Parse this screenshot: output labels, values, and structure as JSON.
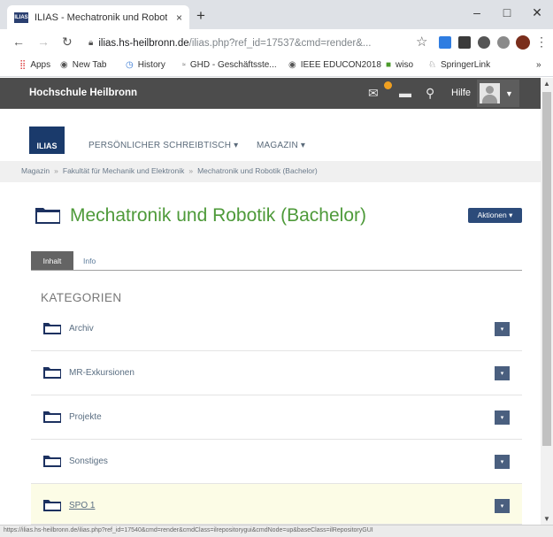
{
  "browser": {
    "tab_title": "ILIAS - Mechatronik und Robotik",
    "tab_close": "×",
    "new_tab": "+",
    "window_minimize": "–",
    "window_maximize": "□",
    "window_close": "✕",
    "url_host": "ilias.hs-heilbronn.de",
    "url_path": "/ilias.php?ref_id=17537&cmd=render&...",
    "bookmarks": [
      {
        "label": "Apps",
        "icon": "apps-grid-icon"
      },
      {
        "label": "New Tab",
        "icon": "chrome-icon"
      },
      {
        "label": "History",
        "icon": "history-icon"
      },
      {
        "label": "GHD - Geschäftsste...",
        "icon": "ghd-icon"
      },
      {
        "label": "IEEE EDUCON2018",
        "icon": "globe-icon"
      },
      {
        "label": "wiso",
        "icon": "wiso-icon"
      },
      {
        "label": "SpringerLink",
        "icon": "springer-icon"
      }
    ],
    "bookmarks_more": "»",
    "status_url": "https://ilias.hs-heilbronn.de/ilias.php?ref_id=17540&cmd=render&cmdClass=ilrepositorygui&cmdNode=up&baseClass=ilRepositoryGUI"
  },
  "ilias": {
    "brand": "Hochschule Heilbronn",
    "help": "Hilfe",
    "logo": "ILIAS",
    "mainnav": {
      "desk": "PERSÖNLICHER SCHREIBTISCH ▾",
      "magazin": "MAGAZIN ▾"
    },
    "breadcrumb": [
      "Magazin",
      "Fakultät für Mechanik und Elektronik",
      "Mechatronik und Robotik (Bachelor)"
    ],
    "breadcrumb_sep": "»",
    "page_title": "Mechatronik und Robotik (Bachelor)",
    "actions_button": "Aktionen ▾",
    "tabs": {
      "active": "Inhalt",
      "info": "Info"
    },
    "categories_heading": "KATEGORIEN",
    "categories": [
      {
        "label": "Archiv"
      },
      {
        "label": "MR-Exkursionen"
      },
      {
        "label": "Projekte"
      },
      {
        "label": "Sonstiges"
      },
      {
        "label": "SPO 1"
      }
    ],
    "row_action_symbol": "▾"
  },
  "colors": {
    "title_green": "#4e9a3a",
    "topbar": "#4c4c4c",
    "action_blue": "#2c4b7a",
    "highlight_row": "#fcfce6"
  }
}
